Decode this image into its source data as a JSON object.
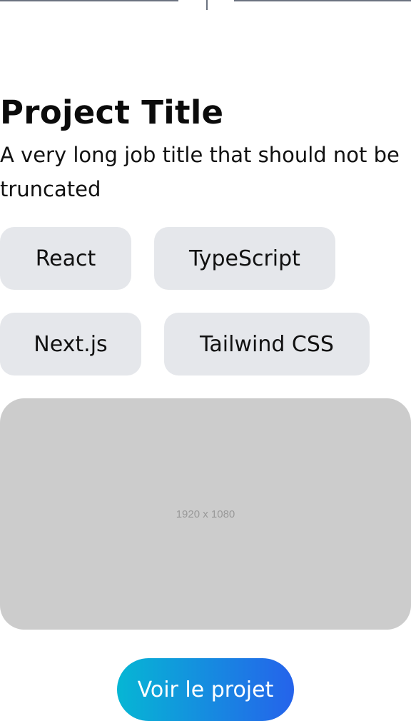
{
  "project": {
    "title": "Project Title",
    "subtitle": "A very long job title that should not be truncated"
  },
  "tags": [
    "React",
    "TypeScript",
    "Next.js",
    "Tailwind CSS"
  ],
  "preview": {
    "placeholder_label": "1920 x 1080"
  },
  "cta": {
    "label": "Voir le projet"
  },
  "colors": {
    "tag_background": "#e5e7eb",
    "preview_background": "#cccccc",
    "cta_gradient_start": "#06b6d4",
    "cta_gradient_end": "#2563eb",
    "timeline_line": "#6b7280"
  }
}
